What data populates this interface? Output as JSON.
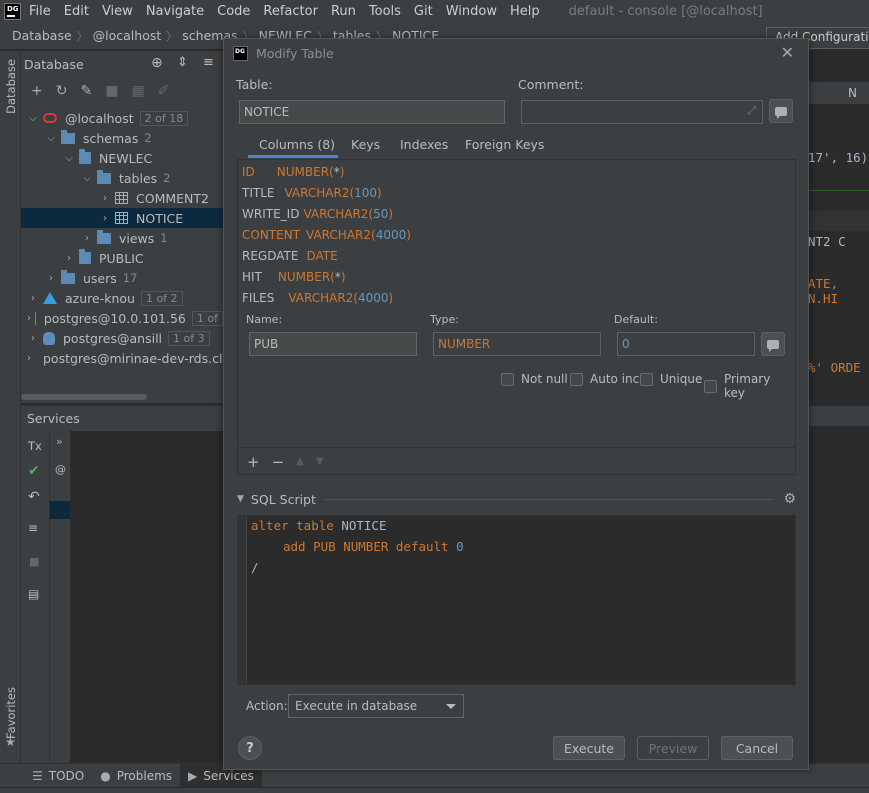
{
  "menu": {
    "items": [
      "File",
      "Edit",
      "View",
      "Navigate",
      "Code",
      "Refactor",
      "Run",
      "Tools",
      "Git",
      "Window",
      "Help"
    ],
    "window_title": "default - console [@localhost]"
  },
  "breadcrumb": {
    "items": [
      "Database",
      "@localhost",
      "schemas",
      "NEWLEC",
      "tables",
      "NOTICE"
    ],
    "add_config": "Add Configuratio"
  },
  "left_stripe": {
    "database": "Database",
    "favorites": "Favorites"
  },
  "db_panel": {
    "title": "Database",
    "tree": [
      {
        "label": "@localhost",
        "badge": "2 of 18"
      },
      {
        "label": "schemas",
        "count": "2"
      },
      {
        "label": "NEWLEC"
      },
      {
        "label": "tables",
        "count": "2"
      },
      {
        "label": "COMMENT2"
      },
      {
        "label": "NOTICE"
      },
      {
        "label": "views",
        "count": "1"
      },
      {
        "label": "PUBLIC"
      },
      {
        "label": "users",
        "count": "17"
      },
      {
        "label": "azure-knou",
        "badge": "1 of 2"
      },
      {
        "label": "postgres@10.0.101.56",
        "badge": "1 of"
      },
      {
        "label": "postgres@ansill",
        "badge": "1 of 3"
      },
      {
        "label": "postgres@mirinae-dev-rds.clu"
      }
    ]
  },
  "services": {
    "title": "Services",
    "tx_label": "Tx",
    "at": "@"
  },
  "editor_snippets": {
    "s1": "17', 16)",
    "s2": "NT2 C",
    "s3": "ATE, N.HI",
    "s4": "%' ORDE",
    "tab": "N"
  },
  "bottom_tabs": {
    "todo": "TODO",
    "problems": "Problems",
    "services": "Services"
  },
  "dialog": {
    "title": "Modify Table",
    "table_label": "Table:",
    "table_value": "NOTICE",
    "comment_label": "Comment:",
    "comment_value": "",
    "tabs": [
      "Columns (8)",
      "Keys",
      "Indexes",
      "Foreign Keys"
    ],
    "columns": [
      {
        "name": "ID",
        "type": "NUMBER",
        "arg": "*"
      },
      {
        "name": "TITLE",
        "type": "VARCHAR2",
        "arg": "100"
      },
      {
        "name": "WRITE_ID",
        "type": "VARCHAR2",
        "arg": "50"
      },
      {
        "name": "CONTENT",
        "type": "VARCHAR2",
        "arg": "4000"
      },
      {
        "name": "REGDATE",
        "type": "DATE",
        "arg": ""
      },
      {
        "name": "HIT",
        "type": "NUMBER",
        "arg": "*"
      },
      {
        "name": "FILES",
        "type": "VARCHAR2",
        "arg": "4000"
      }
    ],
    "name_label": "Name:",
    "name_value": "PUB",
    "type_label": "Type:",
    "type_value": "NUMBER",
    "default_label": "Default:",
    "default_value": "0",
    "checkboxes": [
      "Not null",
      "Auto inc",
      "Unique",
      "Primary key"
    ],
    "sql_title": "SQL Script",
    "sql": {
      "l1_kw": "alter table",
      "l1_id": " NOTICE",
      "l2_kw1": "add",
      "l2_id": " PUB ",
      "l2_kw2": "NUMBER default",
      "l2_num": " 0",
      "l3": "/"
    },
    "action_label": "Action:",
    "action_value": "Execute in database",
    "buttons": {
      "execute": "Execute",
      "preview": "Preview",
      "cancel": "Cancel",
      "help": "?"
    }
  }
}
